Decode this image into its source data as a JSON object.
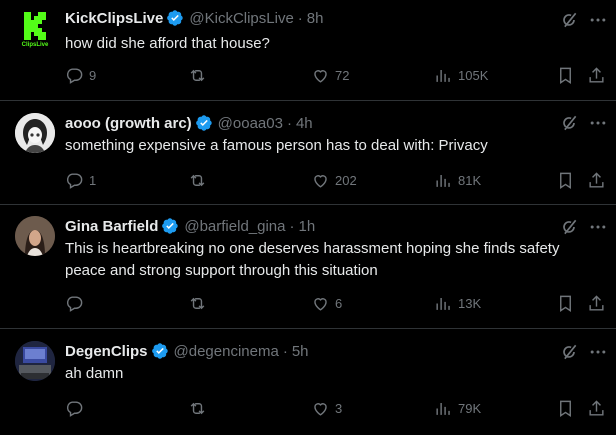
{
  "tweets": [
    {
      "name": "KickClipsLive",
      "handle": "@KickClipsLive",
      "time": "8h",
      "lines": [
        "how did she afford that house?"
      ],
      "replies": "9",
      "reposts": "",
      "likes": "72",
      "views": "105K",
      "avatar_text": "ClipsLive"
    },
    {
      "name": "aooo (growth arc)",
      "handle": "@ooaa03",
      "time": "4h",
      "lines": [
        "something expensive a famous person has to deal with: Privacy"
      ],
      "replies": "1",
      "reposts": "",
      "likes": "202",
      "views": "81K"
    },
    {
      "name": "Gina Barfield",
      "handle": "@barfield_gina",
      "time": "1h",
      "lines": [
        "This is heartbreaking no one deserves harassment hoping she finds safety",
        "peace and strong support through this situation"
      ],
      "replies": "",
      "reposts": "",
      "likes": "6",
      "views": "13K"
    },
    {
      "name": "DegenClips",
      "handle": "@degencinema",
      "time": "5h",
      "lines": [
        "ah damn"
      ],
      "replies": "",
      "reposts": "",
      "likes": "3",
      "views": "79K"
    }
  ],
  "icons": {
    "reply": "reply-icon",
    "repost": "repost-icon",
    "like": "heart-icon",
    "views": "views-icon",
    "bookmark": "bookmark-icon",
    "share": "share-icon",
    "grok": "grok-icon",
    "more": "more-icon",
    "verified": "verified-badge-icon"
  },
  "colors": {
    "background": "#000000",
    "text": "#e7e9ea",
    "muted": "#71767b",
    "divider": "#2f3336",
    "verified": "#1d9bf0",
    "kick_green": "#53fc18"
  }
}
